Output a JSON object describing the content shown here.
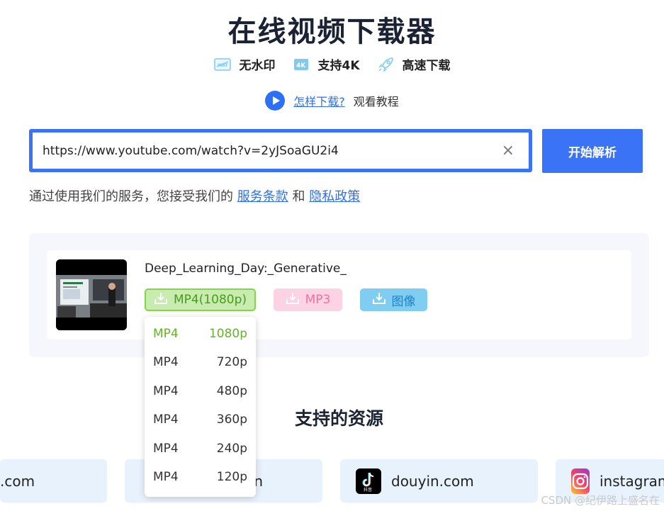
{
  "header": {
    "title": "在线视频下载器"
  },
  "features": [
    {
      "icon": "no-watermark-icon",
      "label": "无水印"
    },
    {
      "icon": "4k-icon",
      "label": "支持4K"
    },
    {
      "icon": "rocket-icon",
      "label": "高速下载"
    }
  ],
  "howto": {
    "link": "怎样下载?",
    "text": "观看教程"
  },
  "search": {
    "value": "https://www.youtube.com/watch?v=2yJSoaGU2i4",
    "clear": "×",
    "button": "开始解析"
  },
  "terms": {
    "prefix": "通过使用我们的服务，您接受我们的",
    "service": "服务条款",
    "and": "和",
    "privacy": "隐私政策"
  },
  "result": {
    "title": "Deep_Learning_Day:_Generative_",
    "buttons": {
      "mp4": "MP4(1080p)",
      "mp3": "MP3",
      "image": "图像"
    },
    "formats": [
      {
        "format": "MP4",
        "quality": "1080p"
      },
      {
        "format": "MP4",
        "quality": "720p"
      },
      {
        "format": "MP4",
        "quality": "480p"
      },
      {
        "format": "MP4",
        "quality": "360p"
      },
      {
        "format": "MP4",
        "quality": "240p"
      },
      {
        "format": "MP4",
        "quality": "120p"
      }
    ]
  },
  "supported": {
    "title": "支持的资源",
    "sources": [
      ".com",
      "n",
      "douyin.com",
      "instagram"
    ]
  },
  "watermark": "CSDN @纪伊路上盛名在",
  "colors": {
    "accent": "#3b73f7",
    "mp4": "#86d34a",
    "mp3": "#fbd3e2",
    "image": "#7fcdf0"
  }
}
